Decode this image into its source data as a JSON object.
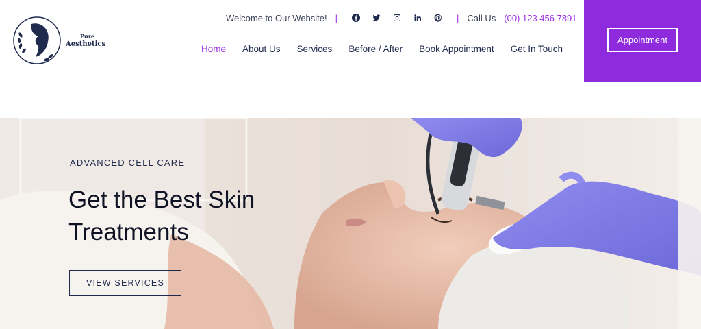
{
  "brand": {
    "line1": "Pure",
    "line2": "Aesthetics"
  },
  "topbar": {
    "welcome": "Welcome to Our Website!",
    "separator": "|",
    "social_icons": [
      "facebook-icon",
      "twitter-icon",
      "instagram-icon",
      "linkedin-icon",
      "pinterest-icon"
    ],
    "call_label": "Call Us -",
    "phone": "(00) 123 456 7891"
  },
  "nav": {
    "items": [
      {
        "label": "Home",
        "active": true
      },
      {
        "label": "About Us"
      },
      {
        "label": "Services"
      },
      {
        "label": "Before / After"
      },
      {
        "label": "Book Appointment"
      },
      {
        "label": "Get In Touch"
      }
    ]
  },
  "header_cta": {
    "label": "Appointment"
  },
  "hero": {
    "eyebrow": "ADVANCED CELL CARE",
    "title_line1": "Get the Best Skin",
    "title_line2": "Treatments",
    "button_label": "VIEW SERVICES"
  },
  "colors": {
    "accent": "#8d2bdd",
    "accent_text": "#9b2fe0",
    "navy": "#1f2a4d",
    "glove": "#7f7ae6"
  }
}
